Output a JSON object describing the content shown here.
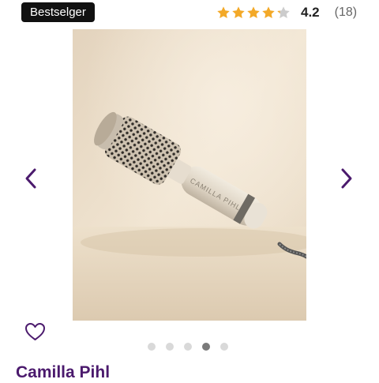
{
  "badge": {
    "label": "Bestselger"
  },
  "rating": {
    "value": "4.2",
    "count": "(18)",
    "stars": 4.2,
    "max_stars": 5,
    "star_color": "#f3a928",
    "star_empty_color": "#cccccc"
  },
  "product": {
    "brand": "Camilla Pihl",
    "image_icon": "hair-dryer-brush-photo",
    "image_lettering": "CAMILLA PIHL"
  },
  "gallery": {
    "dot_count": 5,
    "active_index": 3,
    "prev_icon": "chevron-left-icon",
    "next_icon": "chevron-right-icon"
  },
  "favorite": {
    "icon": "heart-outline-icon"
  },
  "colors": {
    "accent": "#4b1a6d",
    "badge_bg": "#111111"
  }
}
